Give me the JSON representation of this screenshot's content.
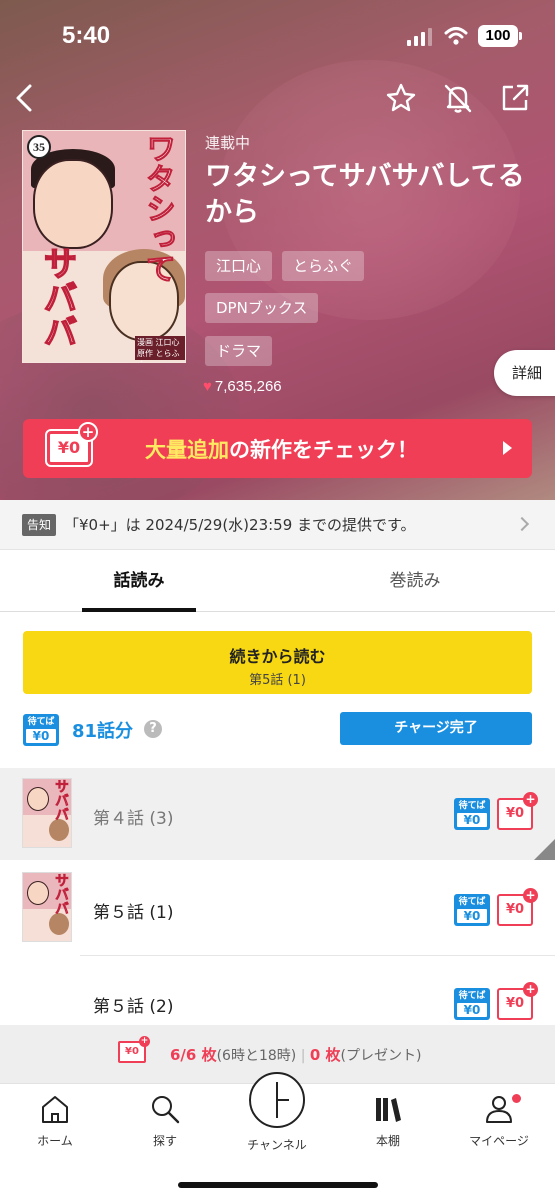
{
  "status_bar": {
    "time": "5:40",
    "battery": "100"
  },
  "header": {
    "back_icon": "chevron-left-icon",
    "actions": [
      "star-icon",
      "bell-off-icon",
      "share-icon"
    ]
  },
  "book": {
    "status": "連載中",
    "title": "ワタシってサバサバしてるから",
    "tags": [
      "江口心",
      "とらふぐ",
      "DPNブックス",
      "ドラマ"
    ],
    "likes": "7,635,266",
    "detail_label": "詳細",
    "cover": {
      "number": "35",
      "title_top": "ワタシって",
      "title_main": "サババ",
      "credit": "漫画 江口心 原作 とらふぐ"
    }
  },
  "banner": {
    "badge": "¥0",
    "text_pre": "大量追加",
    "text_post": "の新作をチェック！"
  },
  "notice": {
    "label": "告知",
    "text": "「¥0+」は 2024/5/29(水)23:59 までの提供です。"
  },
  "tabs": [
    {
      "label": "話読み",
      "active": true
    },
    {
      "label": "巻読み",
      "active": false
    }
  ],
  "continue_button": {
    "label": "続きから読む",
    "sub": "第5話 (1)"
  },
  "wait_free": {
    "badge_top": "待てば",
    "badge_bottom": "¥0",
    "count": "81話分",
    "help": "?",
    "charge_label": "チャージ完了"
  },
  "episodes": [
    {
      "title": "第４話 (3)",
      "read": true,
      "thumb": true
    },
    {
      "title": "第５話 (1)",
      "read": false,
      "thumb": true
    },
    {
      "title": "第５話 (2)",
      "read": false,
      "thumb": false
    }
  ],
  "episode_badges": {
    "wait_top": "待てば",
    "wait_bottom": "¥0",
    "free": "¥0",
    "plus": "+"
  },
  "tickets": {
    "badge": "¥0",
    "count": "6/6 枚",
    "note": "(6時と18時)",
    "sep": "|",
    "present_count": "0 枚",
    "present_note": "(プレゼント)"
  },
  "tabbar": [
    {
      "label": "ホーム",
      "icon": "home-icon"
    },
    {
      "label": "探す",
      "icon": "search-icon"
    },
    {
      "label": "チャンネル",
      "icon": "channel-icon"
    },
    {
      "label": "本棚",
      "icon": "bookshelf-icon"
    },
    {
      "label": "マイページ",
      "icon": "user-icon"
    }
  ],
  "colors": {
    "accent_red": "#ef3e55",
    "accent_blue": "#1a8fe0",
    "continue_yellow": "#f7d812"
  }
}
